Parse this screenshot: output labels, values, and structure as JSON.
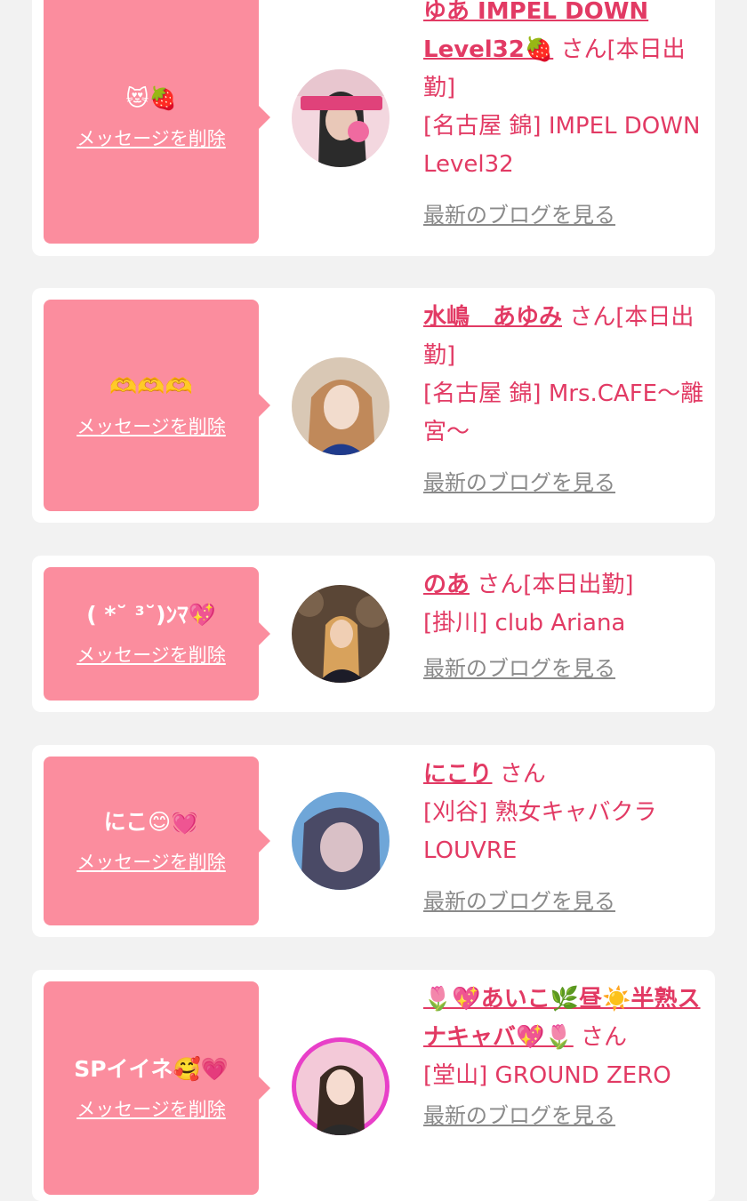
{
  "delete_label": "メッセージを削除",
  "blog_label": "最新のブログを見る",
  "colors": {
    "accent_pink": "#fb8d9e",
    "name_red": "#e23a64",
    "card_bg": "#ffffff",
    "page_bg": "#f2f2f2",
    "link_gray": "#8a8a8a"
  },
  "cards": [
    {
      "message": "😻🍓",
      "name": "ゆあ IMPEL DOWN Level32🍓",
      "san": "さん[本日出勤]",
      "shop": "[名古屋 錦] IMPEL DOWN Level32"
    },
    {
      "message": "🫶🫶🫶",
      "name": "水嶋　あゆみ",
      "san": "さん[本日出勤]",
      "shop": "[名古屋 錦] Mrs.CAFE～離宮～"
    },
    {
      "message": "( *˘ ³˘)ﾝﾏ💖",
      "name": "のあ",
      "san": "さん[本日出勤]",
      "shop": "[掛川] club Ariana"
    },
    {
      "message": "にこ😊💓",
      "name": "にこり",
      "san": "さん",
      "shop": "[刈谷] 熟女キャバクラ LOUVRE"
    },
    {
      "message": "SPイイネ🥰💗",
      "name": "🌷💖あいこ🌿昼☀️半熟スナキャバ💖🌷",
      "san": "さん",
      "shop": "[堂山] GROUND ZERO"
    }
  ]
}
